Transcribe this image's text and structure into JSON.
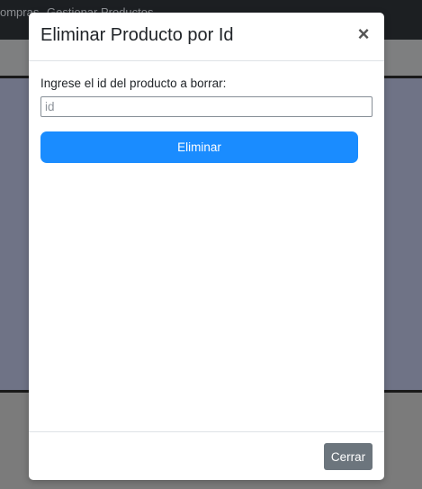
{
  "background": {
    "navbar": {
      "left_text": "ompras",
      "right_text": "Gestionar Productos"
    }
  },
  "modal": {
    "title": "Eliminar Producto por Id",
    "close_icon": "×",
    "label": "Ingrese el id del producto a borrar:",
    "input_placeholder": "id",
    "input_value": "",
    "delete_button_label": "Eliminar",
    "close_button_label": "Cerrar"
  },
  "colors": {
    "primary": "#1a8cff",
    "secondary": "#6c757d",
    "navbar": "#1c1f22"
  }
}
